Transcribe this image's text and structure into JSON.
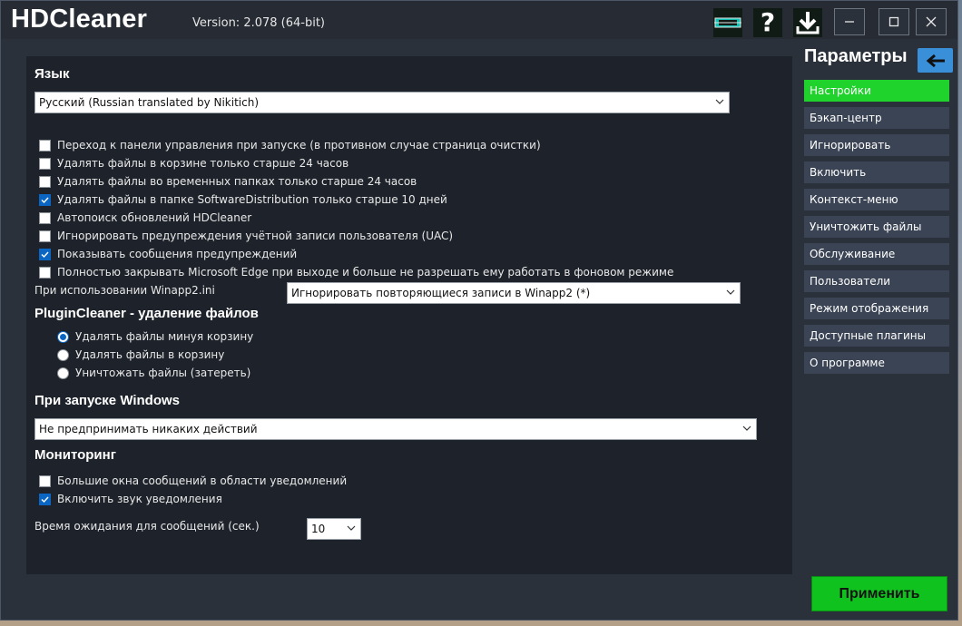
{
  "app": {
    "title": "HDCleaner",
    "version": "Version: 2.078 (64-bit)",
    "icons": [
      "screen-icon",
      "help-icon",
      "download-icon"
    ],
    "window_buttons": [
      "minimize",
      "maximize",
      "close"
    ]
  },
  "language": {
    "heading": "Язык",
    "selected": "Русский (Russian translated by Nikitich)"
  },
  "options": [
    {
      "label": "Переход к панели управления при запуске (в противном случае страница очистки)",
      "checked": false
    },
    {
      "label": "Удалять файлы в корзине только старше 24 часов",
      "checked": false
    },
    {
      "label": "Удалять файлы во временных папках только старше 24 часов",
      "checked": false
    },
    {
      "label": "Удалять файлы в папке SoftwareDistribution только старше 10 дней",
      "checked": true
    },
    {
      "label": "Автопоиск обновлений HDCleaner",
      "checked": false
    },
    {
      "label": "Игнорировать предупреждения учётной записи пользователя (UAC)",
      "checked": false
    },
    {
      "label": "Показывать сообщения предупреждений",
      "checked": true
    },
    {
      "label": "Полностью закрывать Microsoft Edge при выходе и больше не разрешать ему работать в фоновом режиме",
      "checked": false
    }
  ],
  "winapp": {
    "label": "При использовании Winapp2.ini",
    "selected": "Игнорировать повторяющиеся записи в Winapp2 (*)"
  },
  "plugin": {
    "heading": "PluginCleaner - удаление файлов",
    "options": [
      {
        "label": "Удалять файлы минуя корзину",
        "selected": true
      },
      {
        "label": "Удалять файлы в корзину",
        "selected": false
      },
      {
        "label": "Уничтожать файлы (затереть)",
        "selected": false
      }
    ]
  },
  "startup": {
    "heading": "При запуске Windows",
    "selected": "Не предпринимать никаких действий"
  },
  "monitoring": {
    "heading": "Мониторинг",
    "options": [
      {
        "label": "Большие окна сообщений в области уведомлений",
        "checked": false
      },
      {
        "label": "Включить звук уведомления",
        "checked": true
      }
    ],
    "timeout_label": "Время ожидания для сообщений (сек.)",
    "timeout_value": "10"
  },
  "sidebar": {
    "title": "Параметры",
    "items": [
      {
        "label": "Настройки",
        "active": true
      },
      {
        "label": "Бэкап-центр",
        "active": false
      },
      {
        "label": "Игнорировать",
        "active": false
      },
      {
        "label": "Включить",
        "active": false
      },
      {
        "label": "Контекст-меню",
        "active": false
      },
      {
        "label": "Уничтожить файлы",
        "active": false
      },
      {
        "label": "Обслуживание",
        "active": false
      },
      {
        "label": "Пользователи",
        "active": false
      },
      {
        "label": "Режим отображения",
        "active": false
      },
      {
        "label": "Доступные плагины",
        "active": false
      },
      {
        "label": "О программе",
        "active": false
      }
    ]
  },
  "apply_label": "Применить",
  "colors": {
    "window_bg": "#2b313b",
    "panel_bg": "#1e232b",
    "nav_item": "#3b4454",
    "nav_active": "#1fd22c",
    "apply": "#10c21e",
    "accent_blue": "#0a66c2",
    "back_button": "#3a8fd9"
  }
}
